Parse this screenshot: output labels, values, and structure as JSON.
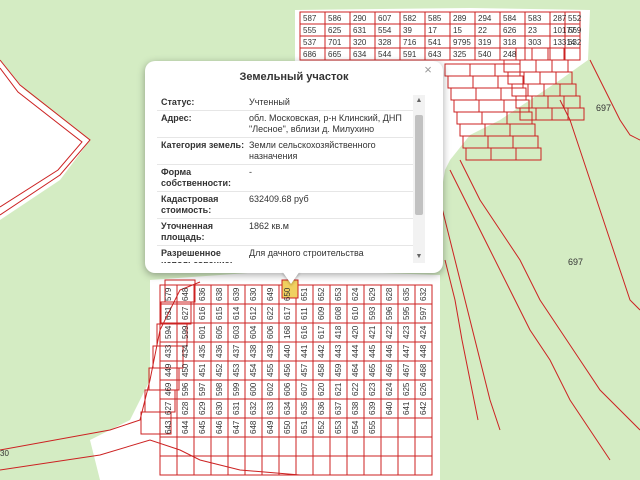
{
  "map": {
    "background_color": "#d4ecc3",
    "boundary_color": "#cc2222",
    "selected_color": "#f0d060",
    "labels_top": [
      "587",
      "586",
      "290",
      "607",
      "582",
      "585",
      "289",
      "294",
      "584",
      "583",
      "287",
      "552",
      "555",
      "625",
      "631",
      "554",
      "39",
      "17",
      "15",
      "22",
      "626",
      "23",
      "10177",
      "669",
      "537",
      "701",
      "320",
      "328",
      "716",
      "541",
      "9795",
      "319",
      "318",
      "303",
      "13314",
      "632",
      "686",
      "665",
      "634",
      "544",
      "591",
      "643",
      "325",
      "540",
      "248"
    ],
    "labels_right": [
      "697",
      "697"
    ],
    "labels_lower": [
      "579",
      "648",
      "636",
      "638",
      "639",
      "630",
      "649",
      "650",
      "651",
      "652",
      "653",
      "624",
      "629",
      "628",
      "635",
      "632",
      "631",
      "627",
      "616",
      "615",
      "614",
      "612",
      "622",
      "617",
      "611",
      "609",
      "608",
      "610",
      "593",
      "596",
      "595",
      "597",
      "594",
      "599",
      "601",
      "605",
      "603",
      "604",
      "606",
      "168",
      "616",
      "617",
      "418",
      "420",
      "421",
      "422",
      "423",
      "424",
      "433",
      "434",
      "435",
      "436",
      "437",
      "438",
      "439",
      "440",
      "441",
      "442",
      "443",
      "444",
      "445",
      "446",
      "447",
      "448",
      "449",
      "450",
      "451",
      "452",
      "453",
      "454",
      "455",
      "456",
      "457",
      "458",
      "459",
      "464",
      "465",
      "466",
      "467",
      "468",
      "469",
      "596",
      "597",
      "598",
      "599",
      "600",
      "602",
      "606",
      "607",
      "620",
      "621",
      "622",
      "623",
      "624",
      "625",
      "626",
      "627",
      "628",
      "629",
      "630",
      "631",
      "632",
      "633",
      "634",
      "635",
      "636",
      "637",
      "638",
      "639",
      "640",
      "641",
      "642",
      "643",
      "644",
      "645",
      "646",
      "647",
      "648",
      "649",
      "650",
      "651",
      "652",
      "653",
      "654",
      "655"
    ],
    "left_edge_label": "30"
  },
  "popup": {
    "title": "Земельный участок",
    "close_label": "×",
    "rows": [
      {
        "key": "Статус:",
        "value": "Учтенный"
      },
      {
        "key": "Адрес:",
        "value": "обл. Московская, р-н Клинский, ДНП \"Лесное\", вблизи д. Милухино"
      },
      {
        "key": "Категория земель:",
        "value": "Земли сельскохозяйственного назначения"
      },
      {
        "key": "Форма собственности:",
        "value": "-"
      },
      {
        "key": "Кадастровая стоимость:",
        "value": "632409.68 руб"
      },
      {
        "key": "Уточненная площадь:",
        "value": "1862 кв.м"
      },
      {
        "key": "Разрешенное использование:",
        "value": "Для дачного строительства"
      }
    ]
  }
}
